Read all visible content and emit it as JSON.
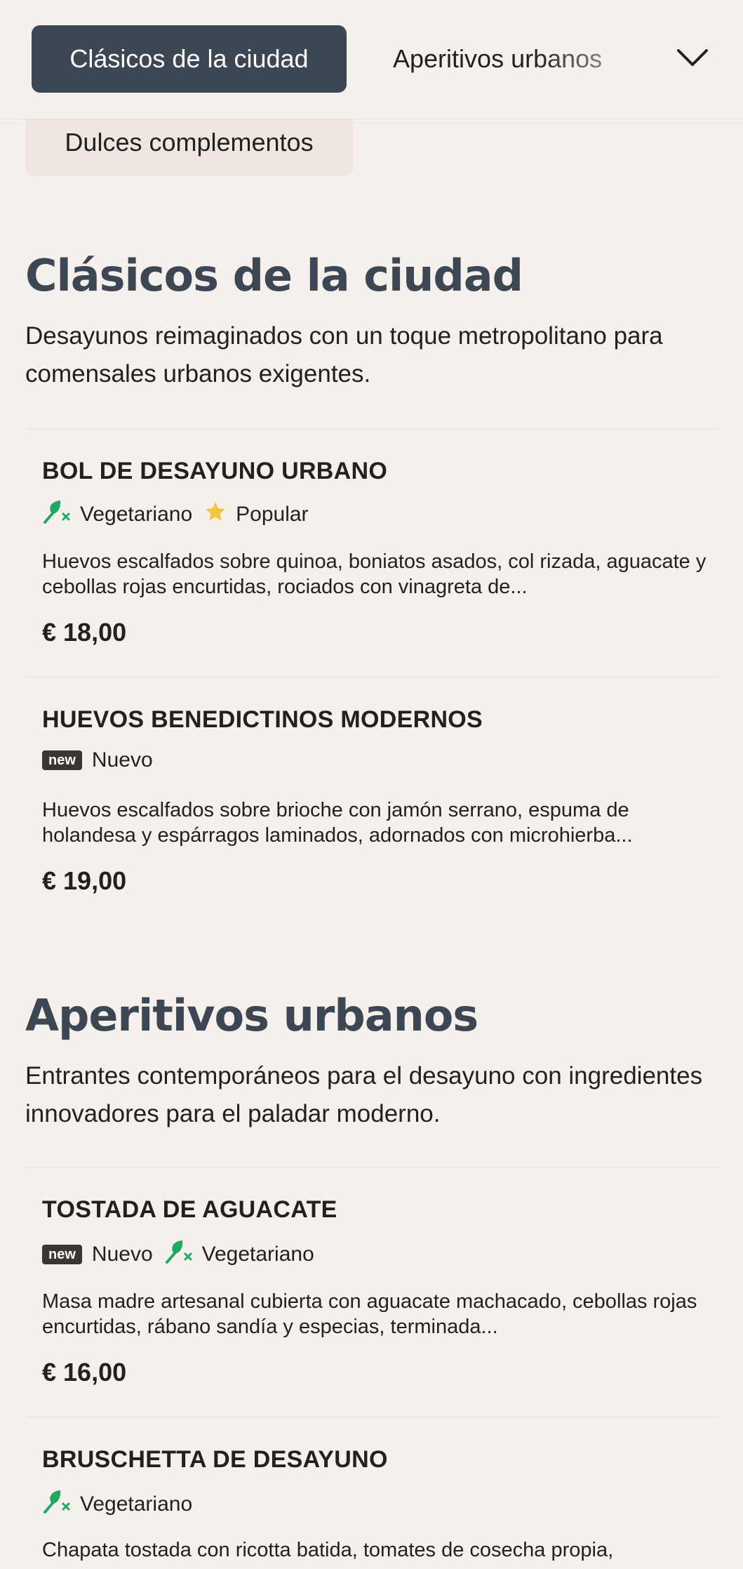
{
  "category_nav": {
    "active_tab": "Clásicos de la ciudad",
    "tab_2": "Aperitivos urbanos",
    "tab_3": "Dulces complementos",
    "expand_icon": "chevron-down-icon"
  },
  "sections": [
    {
      "title": "Clásicos de la ciudad",
      "description": "Desayunos reimaginados con un toque metropolitano para comensales urbanos exigentes.",
      "items": [
        {
          "name": "BOL DE DESAYUNO URBANO",
          "tags": [
            "Vegetariano",
            "Popular"
          ],
          "description": "Huevos escalfados sobre quinoa, boniatos asados, col rizada, aguacate y cebollas rojas encurtidas, rociados con vinagreta de...",
          "price": "€ 18,00"
        },
        {
          "name": "HUEVOS BENEDICTINOS MODERNOS",
          "tags": [
            "Nuevo"
          ],
          "description": "Huevos escalfados sobre brioche con jamón serrano, espuma de holandesa y espárragos laminados, adornados con microhierba...",
          "price": "€ 19,00"
        }
      ]
    },
    {
      "title": "Aperitivos urbanos",
      "description": "Entrantes contemporáneos para el desayuno con ingredientes innovadores para el paladar moderno.",
      "items": [
        {
          "name": "TOSTADA DE AGUACATE",
          "tags": [
            "Nuevo",
            "Vegetariano"
          ],
          "description": "Masa madre artesanal cubierta con aguacate machacado, cebollas rojas encurtidas, rábano sandía y especias, terminada...",
          "price": "€ 16,00"
        },
        {
          "name": "BRUSCHETTA DE DESAYUNO",
          "tags": [
            "Vegetariano"
          ],
          "description": "Chapata tostada con ricotta batida, tomates de cosecha propia,",
          "price": ""
        }
      ]
    }
  ],
  "badges": {
    "new_badge_text": "new",
    "vegetarian_icon": "vegetarian-leaf-icon",
    "popular_icon": "star-icon"
  },
  "colors": {
    "background": "#f5f0ec",
    "active_tab": "#3d4753",
    "heading": "#3d4753",
    "vegetarian_green": "#1fa864",
    "star_yellow": "#f4c542"
  }
}
